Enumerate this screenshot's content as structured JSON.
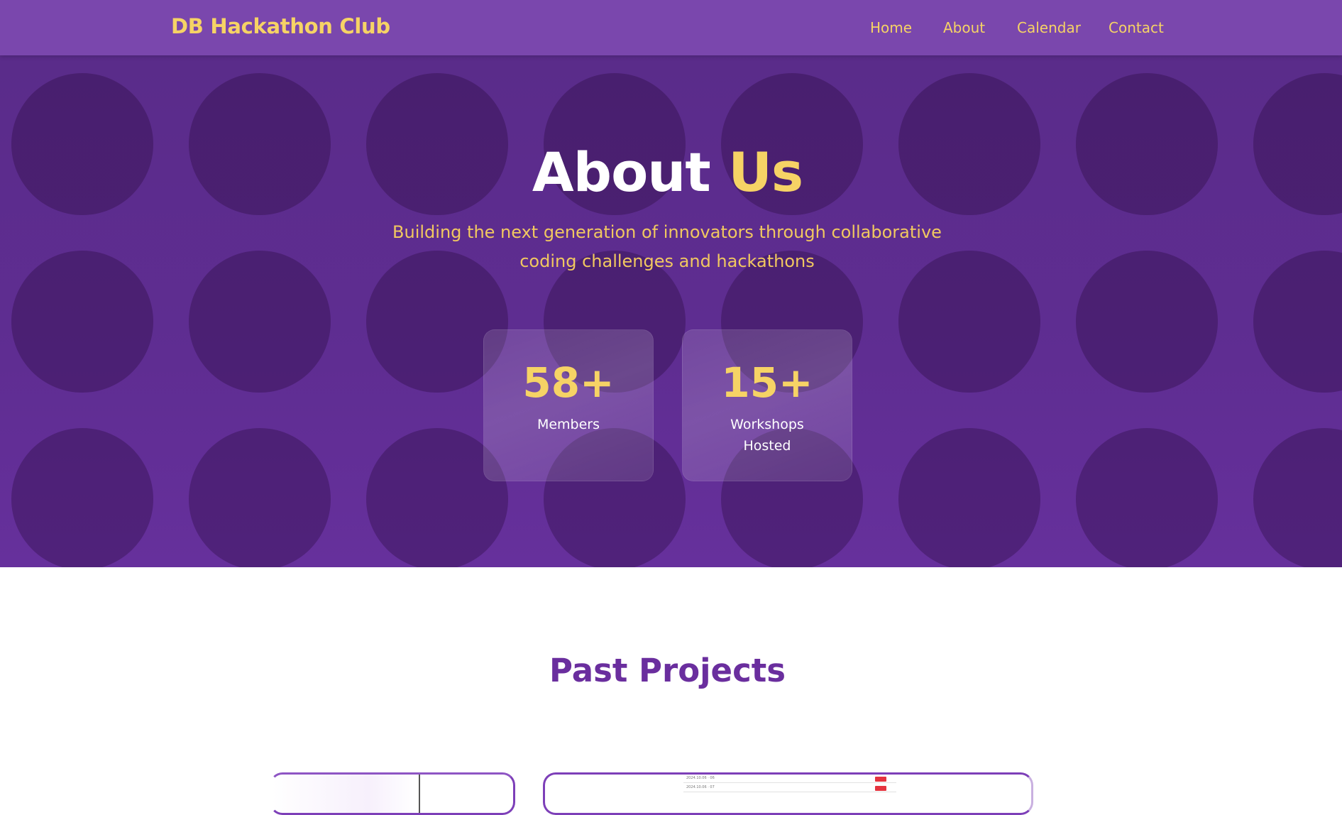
{
  "navbar": {
    "brand": "DB Hackathon Club",
    "links": [
      {
        "label": "Home"
      },
      {
        "label": "About"
      },
      {
        "label": "Calendar"
      },
      {
        "label": "Contact"
      }
    ]
  },
  "hero": {
    "title_main": "About",
    "title_accent": "Us",
    "subtitle": "Building the next generation of innovators through collaborative coding challenges and hackathons",
    "stats": [
      {
        "number": "58+",
        "label": "Members"
      },
      {
        "number": "15+",
        "label": "Workshops Hosted"
      }
    ]
  },
  "projects": {
    "title": "Past Projects",
    "preview_rows": [
      {
        "text": "2024.10.06 · 06"
      },
      {
        "text": "2024.10.06 · 07"
      }
    ]
  },
  "colors": {
    "navbar": "#7a47ad",
    "hero": "#5f2d92",
    "accent_yellow": "#f6d365",
    "section_title": "#6a2e9e",
    "project_border": "#7d3fb8"
  }
}
